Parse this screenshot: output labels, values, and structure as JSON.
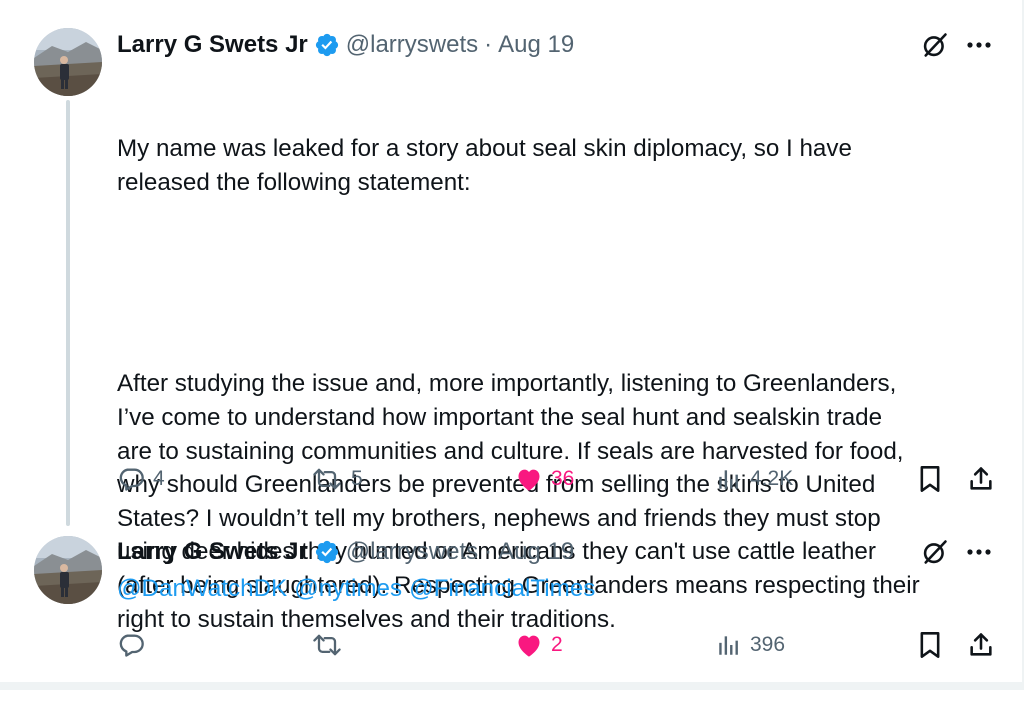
{
  "tweets": [
    {
      "author": "Larry G Swets Jr",
      "handle": "@larryswets",
      "separator": "·",
      "date": "Aug 19",
      "paragraphs": [
        "My name was leaked for a story about seal skin diplomacy, so I have\nreleased the following statement:",
        "After studying the issue and, more importantly, listening to Greenlanders,\nI’ve come to understand how important the seal hunt and sealskin trade\nare to sustaining communities and culture. If seals are harvested for food,\nwhy should Greenlanders be prevented from selling the skins to United\nStates? I wouldn’t tell my brothers, nephews and friends they must stop\nusing deer hides they hunted or Americans they can't use cattle leather\n(after being slaughtered). Respecting Greenlanders means respecting their\nright to sustain themselves and their traditions."
      ],
      "actions": {
        "replies": "4",
        "reposts": "5",
        "likes": "36",
        "views": "4.2K"
      }
    },
    {
      "author": "Larry G Swets Jr",
      "handle": "@larryswets",
      "separator": "·",
      "date": "Aug 19",
      "mentions": [
        "@DanWatchDK",
        "@nytimes",
        "@FinancialTimes"
      ],
      "actions": {
        "replies": "",
        "reposts": "",
        "likes": "2",
        "views": "396"
      }
    }
  ],
  "icons": {
    "verified": "verified-badge-icon",
    "grok": "grok-icon",
    "more": "more-icon",
    "reply": "reply-icon",
    "repost": "repost-icon",
    "like": "heart-icon",
    "views": "views-icon",
    "bookmark": "bookmark-icon",
    "share": "share-icon"
  },
  "colors": {
    "text": "#0f1419",
    "secondary": "#536471",
    "link": "#1d9bf0",
    "like": "#f91880",
    "verified": "#1d9bf0",
    "thread_line": "#cfd9de"
  }
}
